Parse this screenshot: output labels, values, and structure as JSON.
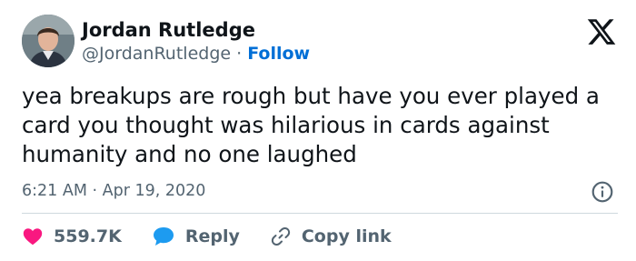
{
  "author": {
    "name": "Jordan Rutledge",
    "handle": "@JordanRutledge",
    "separator": "·",
    "follow_label": "Follow"
  },
  "tweet": {
    "text": "yea breakups are rough but have you ever played a card you thought was hilarious in cards against humanity and no one laughed",
    "time": "6:21 AM",
    "separator": "·",
    "date": "Apr 19, 2020"
  },
  "actions": {
    "likes_count": "559.7K",
    "reply_label": "Reply",
    "copy_link_label": "Copy link"
  },
  "icons": {
    "platform": "x-logo-icon",
    "info": "info-icon",
    "like": "heart-icon",
    "reply": "speech-bubble-icon",
    "copy": "link-icon"
  },
  "colors": {
    "like": "#f91880",
    "reply": "#1d9bf0",
    "follow": "#006fd6",
    "muted": "#536471",
    "text": "#0f1419"
  }
}
